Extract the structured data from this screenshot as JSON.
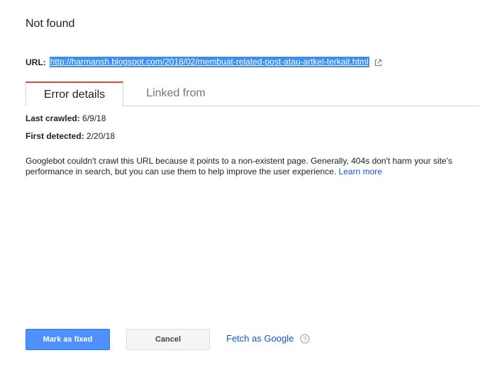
{
  "dialog": {
    "title": "Not found",
    "url_label": "URL:",
    "url_value": "http://harmansh.blogspot.com/2018/02/membuat-related-post-atau-artkel-terkait.html",
    "tabs": [
      {
        "label": "Error details",
        "active": true
      },
      {
        "label": "Linked from",
        "active": false
      }
    ],
    "last_crawled_label": "Last crawled:",
    "last_crawled_value": "6/9/18",
    "first_detected_label": "First detected:",
    "first_detected_value": "2/20/18",
    "description": "Googlebot couldn't crawl this URL because it points to a non-existent page. Generally, 404s don't harm your site's performance in search, but you can use them to help improve the user experience.",
    "learn_more": "Learn more",
    "buttons": {
      "mark_fixed": "Mark as fixed",
      "cancel": "Cancel",
      "fetch": "Fetch as Google"
    }
  },
  "colors": {
    "primary": "#4d90fe",
    "link": "#1155cc",
    "tab_accent": "#dd4b39",
    "selection": "#3b8ef0"
  },
  "icons": {
    "external": "external-link-icon",
    "help": "help-circle-icon"
  }
}
